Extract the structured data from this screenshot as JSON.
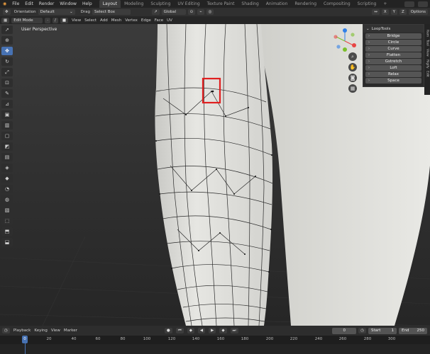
{
  "topbar": {
    "menus": [
      "File",
      "Edit",
      "Render",
      "Window",
      "Help"
    ],
    "workspaces": [
      "Layout",
      "Modeling",
      "Sculpting",
      "UV Editing",
      "Texture Paint",
      "Shading",
      "Animation",
      "Rendering",
      "Compositing",
      "Scripting"
    ],
    "active_workspace": "Layout",
    "add_tab": "+"
  },
  "toolheader": {
    "orientation_label": "Orientation",
    "orientation_value": "Default",
    "drag_label": "Drag",
    "drag_value": "Select Box",
    "transform_value": "Global",
    "options_label": "Options"
  },
  "editheader": {
    "mode": "Edit Mode",
    "menus": [
      "View",
      "Select",
      "Add",
      "Mesh",
      "Vertex",
      "Edge",
      "Face",
      "UV"
    ]
  },
  "viewport": {
    "label": "User Perspective",
    "highlight_color": "#e02020"
  },
  "gizmo": {
    "x_color": "#e84545",
    "y_color": "#7bbf2a",
    "z_color": "#2f7fe8"
  },
  "npanel": {
    "title": "LoopTools",
    "buttons": [
      "Bridge",
      "Circle",
      "Curve",
      "Flatten",
      "Gstretch",
      "Loft",
      "Relax",
      "Space"
    ],
    "tabs": [
      "Item",
      "Tool",
      "View",
      "Rigify",
      "Edit"
    ]
  },
  "timeline": {
    "menus": [
      "Playback",
      "Keying",
      "View",
      "Marker"
    ],
    "current_frame": "0",
    "start_label": "Start",
    "start_value": "1",
    "end_label": "End",
    "end_value": "250",
    "ruler": [
      "0",
      "20",
      "40",
      "60",
      "80",
      "100",
      "120",
      "140",
      "160",
      "180",
      "200",
      "220",
      "240",
      "260",
      "280",
      "300"
    ]
  }
}
